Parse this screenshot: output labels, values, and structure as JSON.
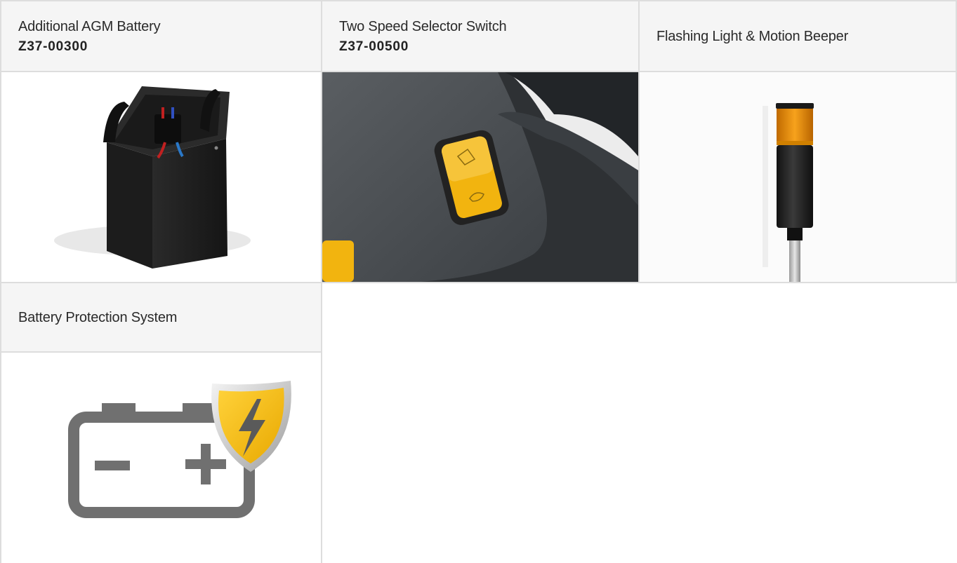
{
  "products": [
    {
      "title": "Additional AGM Battery",
      "code": "Z37-00300",
      "image": "agm-battery-photo"
    },
    {
      "title": "Two Speed Selector Switch",
      "code": "Z37-00500",
      "image": "speed-selector-switch-photo",
      "accent": "#f2b40f"
    },
    {
      "title": "Flashing Light & Motion Beeper",
      "code": "",
      "image": "flashing-light-beeper-photo",
      "accent": "#f0a020"
    },
    {
      "title": "Battery Protection System",
      "code": "",
      "image": "battery-protection-icon",
      "accent": "#f4c21a"
    }
  ],
  "colors": {
    "header_bg": "#f5f5f5",
    "border": "#dddddd",
    "icon_gray": "#707070"
  }
}
